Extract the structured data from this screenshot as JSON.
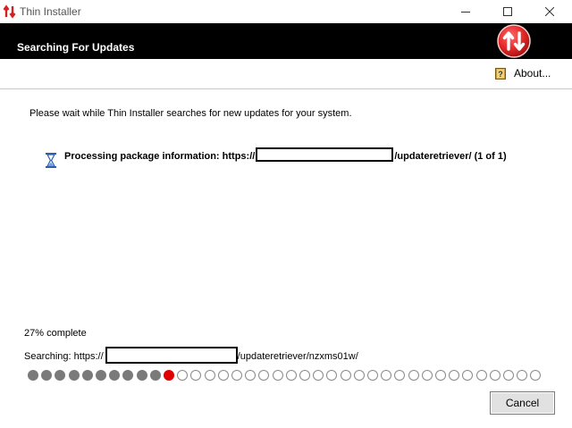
{
  "window": {
    "title": "Thin Installer",
    "controls": {
      "minimize": "minimize-icon",
      "maximize": "maximize-icon",
      "close": "close-icon"
    }
  },
  "banner": {
    "title": "Searching For Updates",
    "logo_icon": "update-logo-icon",
    "background": "#000000",
    "logo_color": "#e52a2a"
  },
  "about": {
    "label": "About...",
    "icon": "help-book-icon"
  },
  "main": {
    "wait_message": "Please wait while Thin Installer searches for new updates for your system.",
    "processing": {
      "icon": "hourglass-icon",
      "prefix": "Processing package information: https://",
      "suffix": "/updateretriever/ (1 of 1)"
    }
  },
  "progress": {
    "percent_text": "27% complete",
    "searching_prefix": "Searching: https://",
    "searching_suffix": "/updateretriever/nzxms01w/",
    "dots_total": 38,
    "dots_done": 10,
    "active_index": 10,
    "colors": {
      "done": "#7a7a7a",
      "active": "#e00000",
      "pending": "#ffffff"
    }
  },
  "buttons": {
    "cancel": "Cancel"
  }
}
